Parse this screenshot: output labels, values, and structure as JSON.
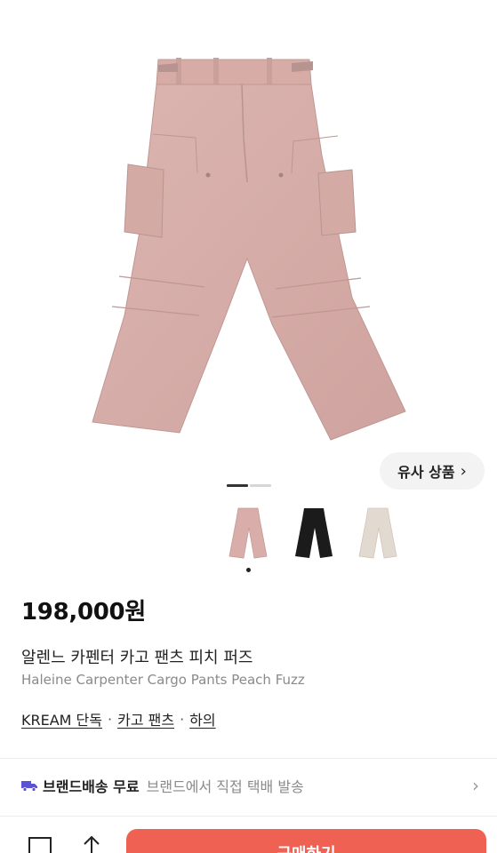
{
  "product": {
    "price": "198,000원",
    "title_ko": "알렌느 카펜터 카고 팬츠 피치 퍼즈",
    "title_en": "Haleine Carpenter Cargo Pants Peach Fuzz",
    "tags": [
      "KREAM 단독",
      "카고 팬츠",
      "하의"
    ],
    "tag_separator": "·"
  },
  "gallery": {
    "similar_label": "유사 상품",
    "similar_chevron": "›",
    "swatches": [
      {
        "name": "peach",
        "color": "#d9aeaa"
      },
      {
        "name": "black",
        "color": "#1b1b1b"
      },
      {
        "name": "beige",
        "color": "#e2dad0"
      }
    ]
  },
  "shipping": {
    "title": "브랜드배송 무료",
    "subtitle": "브랜드에서 직접 택배 발송",
    "icon": "truck-icon",
    "icon_color": "#5b53d6"
  },
  "bottom_bar": {
    "buy_label": "구매하기",
    "save_icon": "bookmark-icon",
    "share_icon": "share-icon",
    "accent": "#ef6253"
  }
}
